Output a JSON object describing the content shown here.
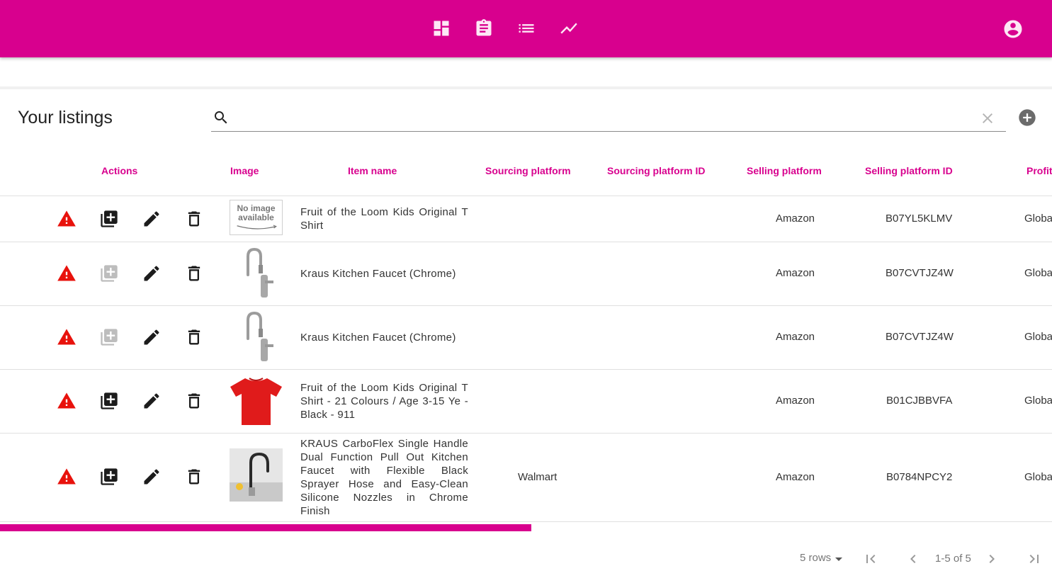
{
  "header": {
    "nav": [
      "dashboard-icon",
      "assignment-icon",
      "list-icon",
      "trending-icon"
    ],
    "account": "account-circle-icon",
    "accent_color": "#d8008e"
  },
  "toolbar": {
    "title": "Your listings",
    "search_value": "",
    "search_placeholder": ""
  },
  "table": {
    "columns": [
      "Actions",
      "Image",
      "Item name",
      "Sourcing platform",
      "Sourcing platform ID",
      "Selling platform",
      "Selling platform ID",
      "Profit"
    ],
    "rows": [
      {
        "image": "No image available",
        "item_name": "Fruit of the Loom Kids Original T Shirt",
        "sourcing_platform": "",
        "sourcing_id": "",
        "selling_platform": "Amazon",
        "selling_id": "B07YL5KLMV",
        "profit": "Global",
        "add_enabled": true
      },
      {
        "image": "faucet",
        "item_name": "Kraus Kitchen Faucet (Chrome)",
        "sourcing_platform": "",
        "sourcing_id": "",
        "selling_platform": "Amazon",
        "selling_id": "B07CVTJZ4W",
        "profit": "Global",
        "add_enabled": false
      },
      {
        "image": "faucet",
        "item_name": "Kraus Kitchen Faucet (Chrome)",
        "sourcing_platform": "",
        "sourcing_id": "",
        "selling_platform": "Amazon",
        "selling_id": "B07CVTJZ4W",
        "profit": "Global",
        "add_enabled": false
      },
      {
        "image": "red-tshirt",
        "item_name": "Fruit of the Loom Kids Original T Shirt - 21 Colours / Age 3-15 Ye - Black - 911",
        "sourcing_platform": "",
        "sourcing_id": "",
        "selling_platform": "Amazon",
        "selling_id": "B01CJBBVFA",
        "profit": "Global",
        "add_enabled": true
      },
      {
        "image": "black-faucet",
        "item_name": "KRAUS CarboFlex Single Handle Dual Function Pull Out Kitchen Faucet with Flexible Black Sprayer Hose and Easy-Clean Silicone Nozzles in Chrome Finish",
        "sourcing_platform": "Walmart",
        "sourcing_id": "",
        "selling_platform": "Amazon",
        "selling_id": "B0784NPCY2",
        "profit": "Global",
        "add_enabled": true
      }
    ]
  },
  "pagination": {
    "rows_label": "5 rows",
    "range_label": "1-5 of 5"
  }
}
